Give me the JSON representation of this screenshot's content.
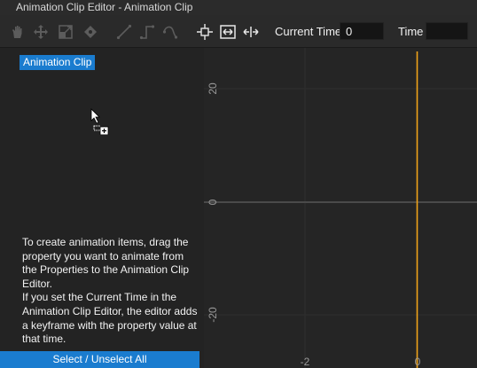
{
  "window": {
    "title": "Animation Clip Editor - Animation Clip"
  },
  "toolbar": {
    "icons": [
      "hand-icon",
      "move-icon",
      "scale-icon",
      "keyframe-icon",
      "linear-curve-icon",
      "step-curve-icon",
      "bezier-curve-icon",
      "center-view-icon",
      "fit-view-icon",
      "fit-horizontal-icon"
    ],
    "current_time_label": "Current Time",
    "current_time_value": "0",
    "time_label": "Time",
    "time_value": ""
  },
  "left_panel": {
    "clip_label": "Animation Clip",
    "help_paragraph_1": "To create animation items, drag the property you want to animate from the Properties to the Animation Clip Editor.",
    "help_paragraph_2": "If you set the Current Time in the Animation Clip Editor, the editor adds a keyframe with the property value at that time.",
    "select_button": "Select / Unselect All"
  },
  "graph": {
    "y_ticks": [
      "20",
      "0",
      "-20"
    ],
    "x_ticks": [
      "-2",
      "0"
    ],
    "colors": {
      "playhead": "#f0a419",
      "zero_line": "#4a4a4a",
      "grid": "#2e2e2e"
    }
  }
}
